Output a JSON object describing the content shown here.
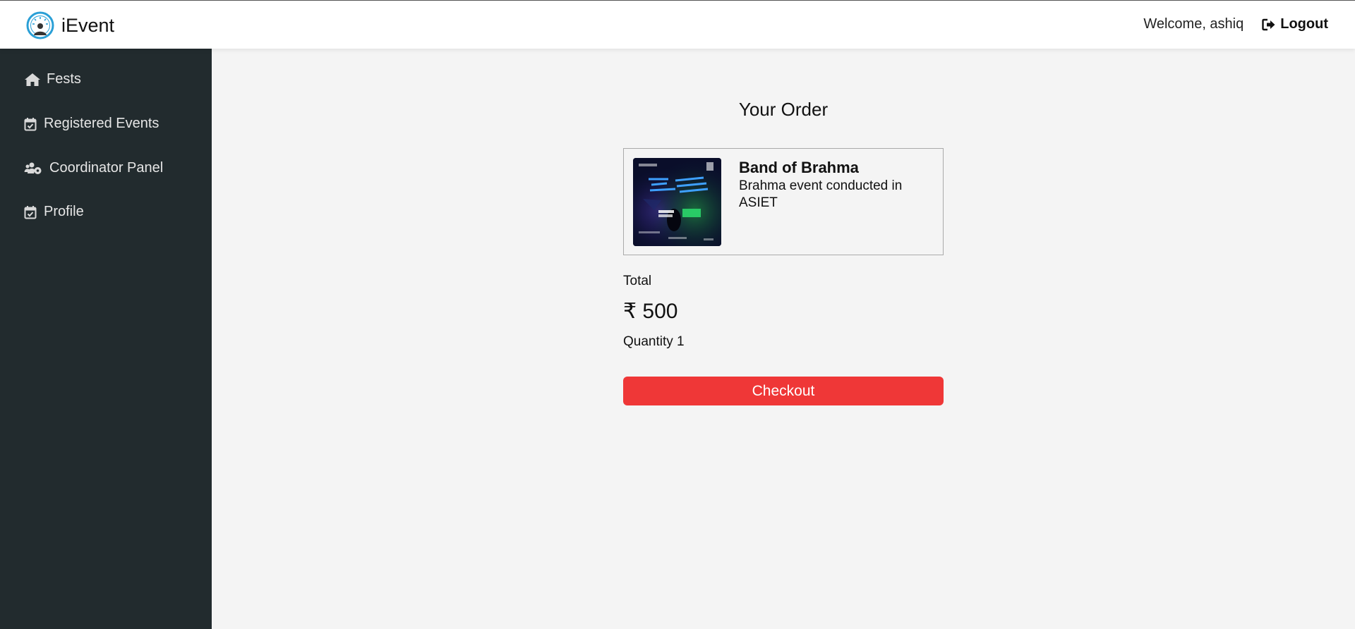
{
  "header": {
    "brand": "iEvent",
    "welcome": "Welcome, ashiq",
    "logout_label": "Logout"
  },
  "sidebar": {
    "items": [
      {
        "label": "Fests",
        "icon": "home-icon"
      },
      {
        "label": "Registered Events",
        "icon": "calendar-check-icon"
      },
      {
        "label": "Coordinator Panel",
        "icon": "users-cog-icon"
      },
      {
        "label": "Profile",
        "icon": "calendar-check-icon"
      }
    ]
  },
  "order": {
    "heading": "Your Order",
    "item": {
      "title": "Band of Brahma",
      "description": "Brahma event conducted in ASIET"
    },
    "total_label": "Total",
    "total_amount": "₹ 500",
    "quantity": "Quantity 1",
    "checkout_label": "Checkout"
  },
  "colors": {
    "sidebar_bg": "#222b2e",
    "page_bg": "#f4f4f4",
    "accent_button": "#ef3737",
    "logo_blue": "#2a9fd6"
  }
}
